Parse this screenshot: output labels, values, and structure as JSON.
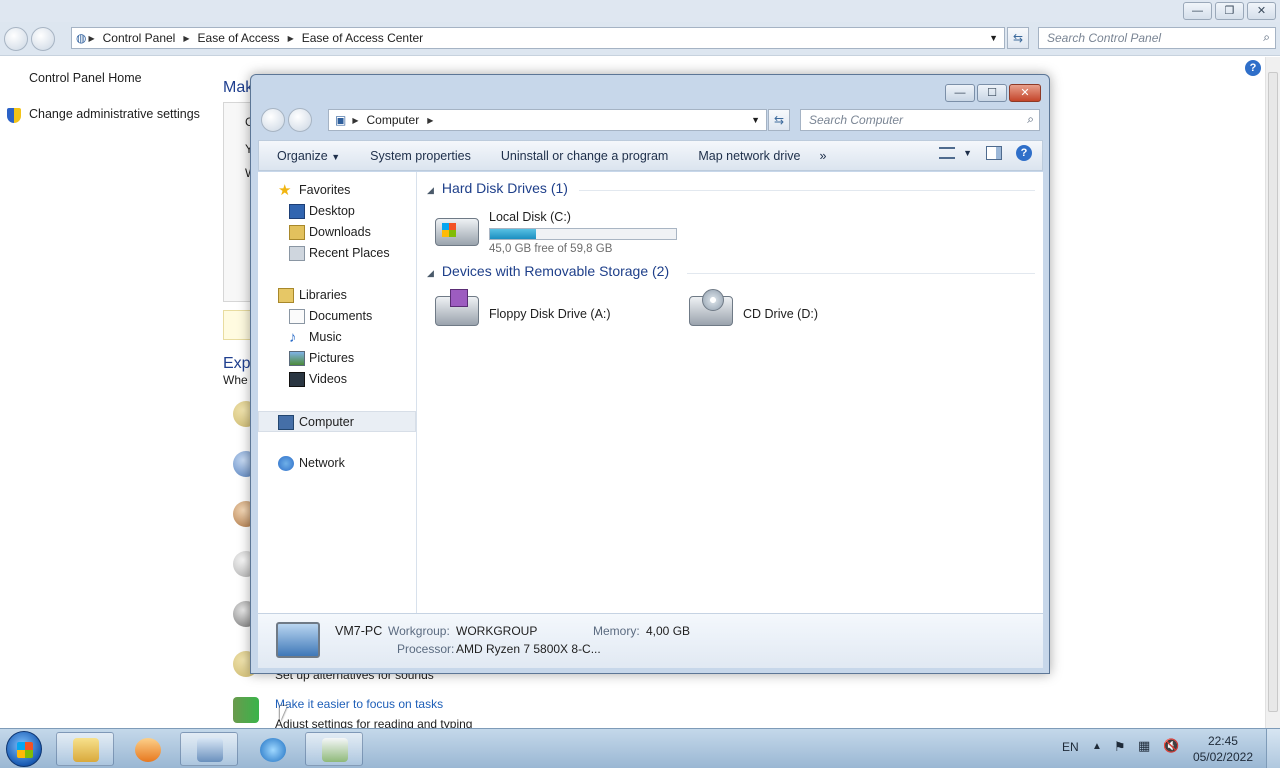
{
  "background_window": {
    "breadcrumb": [
      "Control Panel",
      "Ease of Access",
      "Ease of Access Center"
    ],
    "search_placeholder": "Search Control Panel",
    "left_links": [
      "Control Panel Home",
      "Change administrative settings"
    ],
    "main": {
      "title_fragment": "Mak",
      "box_letters": [
        "C",
        "Y",
        "W"
      ],
      "explore_fragment": "Expl",
      "whe_fragment": "Whe",
      "sounds_sub": "Set up alternatives for sounds",
      "focus_link": "Make it easier to focus on tasks",
      "focus_sub": "Adjust settings for reading and typing"
    }
  },
  "computer_window": {
    "address": "Computer",
    "search_placeholder": "Search Computer",
    "toolbar": {
      "organize": "Organize",
      "system_properties": "System properties",
      "uninstall": "Uninstall or change a program",
      "map_drive": "Map network drive",
      "more": "»"
    },
    "nav": {
      "favorites": "Favorites",
      "desktop": "Desktop",
      "downloads": "Downloads",
      "recent": "Recent Places",
      "libraries": "Libraries",
      "documents": "Documents",
      "music": "Music",
      "pictures": "Pictures",
      "videos": "Videos",
      "computer": "Computer",
      "network": "Network"
    },
    "groups": {
      "hdd": "Hard Disk Drives (1)",
      "removable": "Devices with Removable Storage (2)"
    },
    "drives": {
      "c_name": "Local Disk (C:)",
      "c_free": "45,0 GB free of 59,8 GB",
      "c_used_fraction": 0.247,
      "floppy": "Floppy Disk Drive (A:)",
      "cd": "CD Drive (D:)"
    },
    "details": {
      "pc_name": "VM7-PC",
      "workgroup_label": "Workgroup:",
      "workgroup": "WORKGROUP",
      "memory_label": "Memory:",
      "memory": "4,00 GB",
      "processor_label": "Processor:",
      "processor": "AMD Ryzen 7 5800X 8-C..."
    }
  },
  "taskbar": {
    "lang": "EN",
    "time": "22:45",
    "date": "05/02/2022"
  }
}
